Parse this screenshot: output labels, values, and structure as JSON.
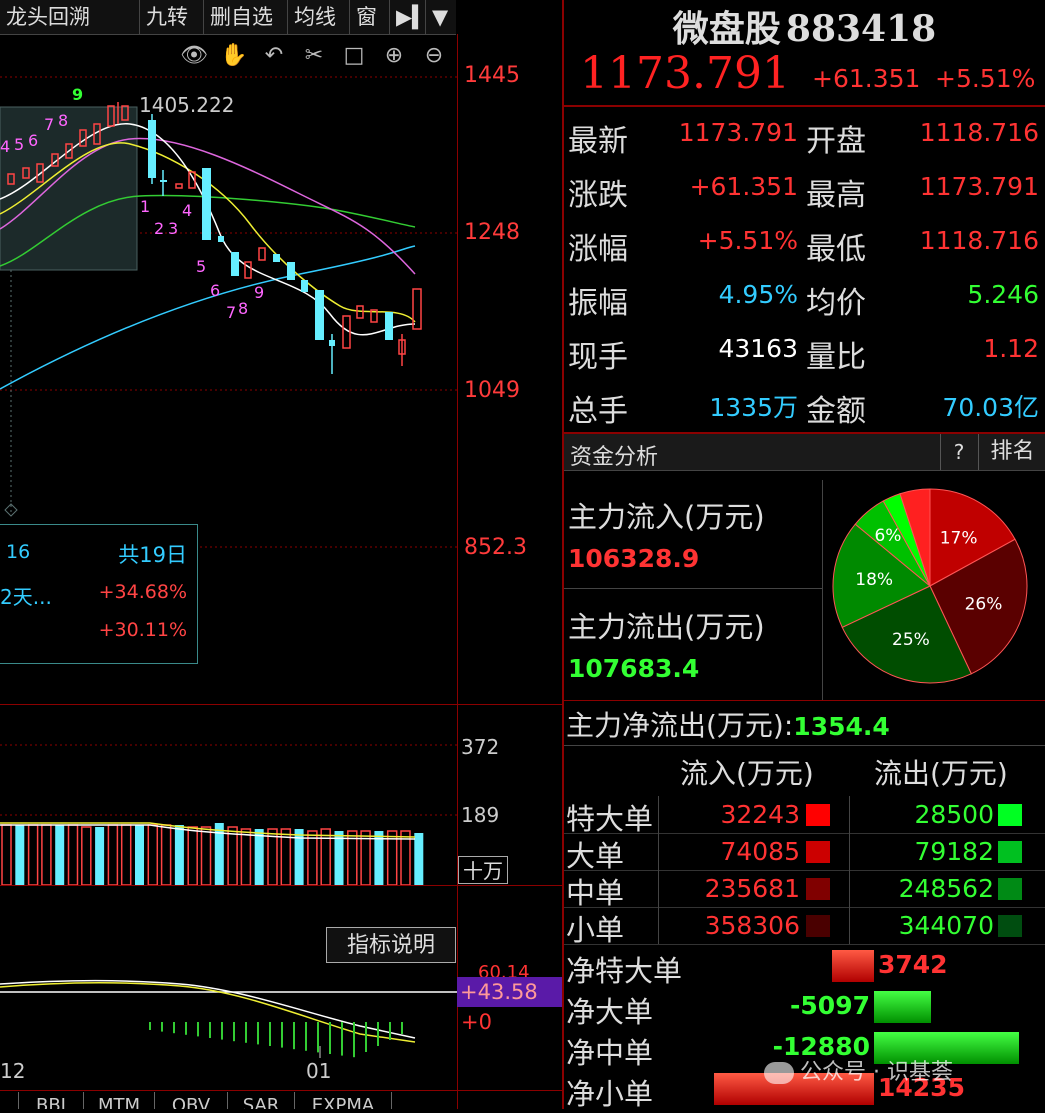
{
  "toolbar": [
    "龙头回溯",
    "九转",
    "删自选",
    "均线",
    "窗"
  ],
  "icons": [
    "eye-icon",
    "hand-icon",
    "undo-icon",
    "scissors-icon",
    "lock-icon",
    "zoom-in-icon",
    "zoom-out-icon"
  ],
  "price_axis": [
    "1445",
    "1248",
    "1049",
    "852.3"
  ],
  "chart": {
    "high_label": "1405.222",
    "nine_count_top": [
      "4",
      "5",
      "6",
      "7",
      "8",
      "9"
    ],
    "nine_count_down": [
      "1",
      "2",
      "3",
      "4",
      "5",
      "6",
      "7",
      "8",
      "9"
    ]
  },
  "infobox": {
    "r1_left": "16",
    "r1_right": "共19日",
    "r2_left": "2天...",
    "r2_right": "+34.68%",
    "r3_right": "+30.11%"
  },
  "volume": {
    "axis": [
      "372",
      "189"
    ],
    "unit": "十万"
  },
  "indicator": {
    "explain": "指标说明",
    "top_value": "60.14",
    "current": "+43.58",
    "zero": "+0",
    "xaxis": [
      "12",
      "01"
    ],
    "tabs": [
      "BBI",
      "MTM",
      "OBV",
      "SAR",
      "EXPMA"
    ]
  },
  "quote": {
    "name": "微盘股",
    "code": "883418",
    "price": "1173.791",
    "change": "+61.351",
    "pct": "+5.51%",
    "rows": [
      {
        "l1": "最新",
        "v1": "1173.791",
        "c1": "red",
        "l2": "开盘",
        "v2": "1118.716",
        "c2": "red"
      },
      {
        "l1": "涨跌",
        "v1": "+61.351",
        "c1": "red",
        "l2": "最高",
        "v2": "1173.791",
        "c2": "red"
      },
      {
        "l1": "涨幅",
        "v1": "+5.51%",
        "c1": "red",
        "l2": "最低",
        "v2": "1118.716",
        "c2": "red"
      },
      {
        "l1": "振幅",
        "v1": "4.95%",
        "c1": "cyan",
        "l2": "均价",
        "v2": "5.246",
        "c2": "green"
      },
      {
        "l1": "现手",
        "v1": "43163",
        "c1": "white",
        "l2": "量比",
        "v2": "1.12",
        "c2": "red"
      },
      {
        "l1": "总手",
        "v1": "1335万",
        "c1": "cyan",
        "l2": "金额",
        "v2": "70.03亿",
        "c2": "cyan"
      }
    ]
  },
  "capital": {
    "title": "资金分析",
    "help": "?",
    "rank": "排名",
    "inflow_label": "主力流入(万元)",
    "inflow_value": "106328.9",
    "outflow_label": "主力流出(万元)",
    "outflow_value": "107683.4",
    "net_label": "主力净流出(万元):",
    "net_value": "1354.4",
    "pie": [
      {
        "pct": 17,
        "label": "17%",
        "color": "#c00000"
      },
      {
        "pct": 26,
        "label": "26%",
        "color": "#5a0000"
      },
      {
        "pct": 25,
        "label": "25%",
        "color": "#004d00"
      },
      {
        "pct": 18,
        "label": "18%",
        "color": "#008a00"
      },
      {
        "pct": 6,
        "label": "6%",
        "color": "#00c000"
      },
      {
        "pct": 3,
        "label": "",
        "color": "#00ff00"
      },
      {
        "pct": 5,
        "label": "",
        "color": "#ff2020"
      }
    ],
    "col_in": "流入(万元)",
    "col_out": "流出(万元)",
    "flows": [
      {
        "label": "特大单",
        "in": "32243",
        "in_color": "#ff0000",
        "out": "28500",
        "out_color": "#00ff22"
      },
      {
        "label": "大单",
        "in": "74085",
        "in_color": "#cc0000",
        "out": "79182",
        "out_color": "#00c020"
      },
      {
        "label": "中单",
        "in": "235681",
        "in_color": "#800000",
        "out": "248562",
        "out_color": "#008a15"
      },
      {
        "label": "小单",
        "in": "358306",
        "in_color": "#4a0000",
        "out": "344070",
        "out_color": "#004d10"
      }
    ],
    "net": [
      {
        "label": "净特大单",
        "value": "3742",
        "amount": 3742,
        "color": "red"
      },
      {
        "label": "净大单",
        "value": "-5097",
        "amount": -5097,
        "color": "green"
      },
      {
        "label": "净中单",
        "value": "-12880",
        "amount": -12880,
        "color": "green"
      },
      {
        "label": "净小单",
        "value": "14235",
        "amount": 14235,
        "color": "red"
      }
    ]
  },
  "watermark": "公众号 · 识基荟"
}
